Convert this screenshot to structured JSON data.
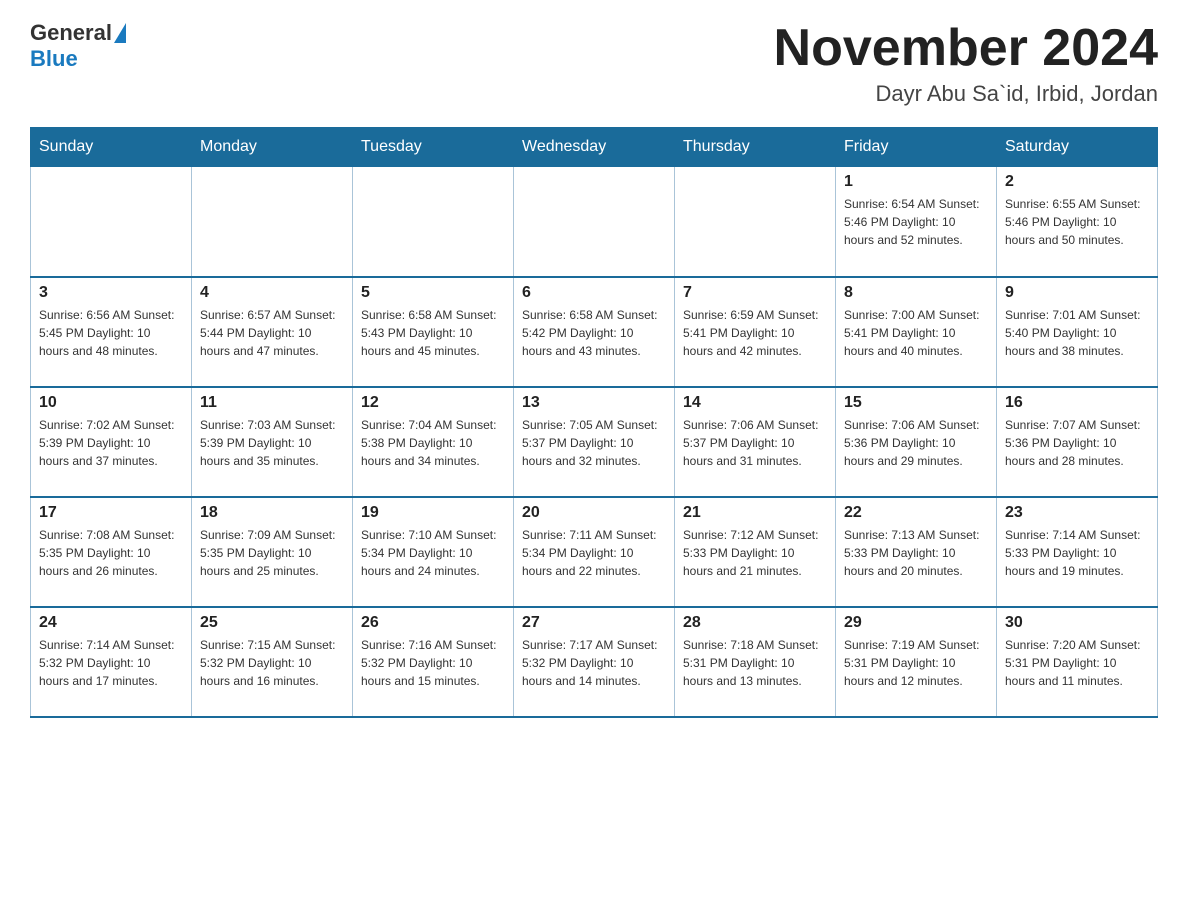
{
  "header": {
    "logo_general": "General",
    "logo_blue": "Blue",
    "month_title": "November 2024",
    "location": "Dayr Abu Sa`id, Irbid, Jordan"
  },
  "weekdays": [
    "Sunday",
    "Monday",
    "Tuesday",
    "Wednesday",
    "Thursday",
    "Friday",
    "Saturday"
  ],
  "weeks": [
    [
      {
        "day": "",
        "info": ""
      },
      {
        "day": "",
        "info": ""
      },
      {
        "day": "",
        "info": ""
      },
      {
        "day": "",
        "info": ""
      },
      {
        "day": "",
        "info": ""
      },
      {
        "day": "1",
        "info": "Sunrise: 6:54 AM\nSunset: 5:46 PM\nDaylight: 10 hours and 52 minutes."
      },
      {
        "day": "2",
        "info": "Sunrise: 6:55 AM\nSunset: 5:46 PM\nDaylight: 10 hours and 50 minutes."
      }
    ],
    [
      {
        "day": "3",
        "info": "Sunrise: 6:56 AM\nSunset: 5:45 PM\nDaylight: 10 hours and 48 minutes."
      },
      {
        "day": "4",
        "info": "Sunrise: 6:57 AM\nSunset: 5:44 PM\nDaylight: 10 hours and 47 minutes."
      },
      {
        "day": "5",
        "info": "Sunrise: 6:58 AM\nSunset: 5:43 PM\nDaylight: 10 hours and 45 minutes."
      },
      {
        "day": "6",
        "info": "Sunrise: 6:58 AM\nSunset: 5:42 PM\nDaylight: 10 hours and 43 minutes."
      },
      {
        "day": "7",
        "info": "Sunrise: 6:59 AM\nSunset: 5:41 PM\nDaylight: 10 hours and 42 minutes."
      },
      {
        "day": "8",
        "info": "Sunrise: 7:00 AM\nSunset: 5:41 PM\nDaylight: 10 hours and 40 minutes."
      },
      {
        "day": "9",
        "info": "Sunrise: 7:01 AM\nSunset: 5:40 PM\nDaylight: 10 hours and 38 minutes."
      }
    ],
    [
      {
        "day": "10",
        "info": "Sunrise: 7:02 AM\nSunset: 5:39 PM\nDaylight: 10 hours and 37 minutes."
      },
      {
        "day": "11",
        "info": "Sunrise: 7:03 AM\nSunset: 5:39 PM\nDaylight: 10 hours and 35 minutes."
      },
      {
        "day": "12",
        "info": "Sunrise: 7:04 AM\nSunset: 5:38 PM\nDaylight: 10 hours and 34 minutes."
      },
      {
        "day": "13",
        "info": "Sunrise: 7:05 AM\nSunset: 5:37 PM\nDaylight: 10 hours and 32 minutes."
      },
      {
        "day": "14",
        "info": "Sunrise: 7:06 AM\nSunset: 5:37 PM\nDaylight: 10 hours and 31 minutes."
      },
      {
        "day": "15",
        "info": "Sunrise: 7:06 AM\nSunset: 5:36 PM\nDaylight: 10 hours and 29 minutes."
      },
      {
        "day": "16",
        "info": "Sunrise: 7:07 AM\nSunset: 5:36 PM\nDaylight: 10 hours and 28 minutes."
      }
    ],
    [
      {
        "day": "17",
        "info": "Sunrise: 7:08 AM\nSunset: 5:35 PM\nDaylight: 10 hours and 26 minutes."
      },
      {
        "day": "18",
        "info": "Sunrise: 7:09 AM\nSunset: 5:35 PM\nDaylight: 10 hours and 25 minutes."
      },
      {
        "day": "19",
        "info": "Sunrise: 7:10 AM\nSunset: 5:34 PM\nDaylight: 10 hours and 24 minutes."
      },
      {
        "day": "20",
        "info": "Sunrise: 7:11 AM\nSunset: 5:34 PM\nDaylight: 10 hours and 22 minutes."
      },
      {
        "day": "21",
        "info": "Sunrise: 7:12 AM\nSunset: 5:33 PM\nDaylight: 10 hours and 21 minutes."
      },
      {
        "day": "22",
        "info": "Sunrise: 7:13 AM\nSunset: 5:33 PM\nDaylight: 10 hours and 20 minutes."
      },
      {
        "day": "23",
        "info": "Sunrise: 7:14 AM\nSunset: 5:33 PM\nDaylight: 10 hours and 19 minutes."
      }
    ],
    [
      {
        "day": "24",
        "info": "Sunrise: 7:14 AM\nSunset: 5:32 PM\nDaylight: 10 hours and 17 minutes."
      },
      {
        "day": "25",
        "info": "Sunrise: 7:15 AM\nSunset: 5:32 PM\nDaylight: 10 hours and 16 minutes."
      },
      {
        "day": "26",
        "info": "Sunrise: 7:16 AM\nSunset: 5:32 PM\nDaylight: 10 hours and 15 minutes."
      },
      {
        "day": "27",
        "info": "Sunrise: 7:17 AM\nSunset: 5:32 PM\nDaylight: 10 hours and 14 minutes."
      },
      {
        "day": "28",
        "info": "Sunrise: 7:18 AM\nSunset: 5:31 PM\nDaylight: 10 hours and 13 minutes."
      },
      {
        "day": "29",
        "info": "Sunrise: 7:19 AM\nSunset: 5:31 PM\nDaylight: 10 hours and 12 minutes."
      },
      {
        "day": "30",
        "info": "Sunrise: 7:20 AM\nSunset: 5:31 PM\nDaylight: 10 hours and 11 minutes."
      }
    ]
  ]
}
